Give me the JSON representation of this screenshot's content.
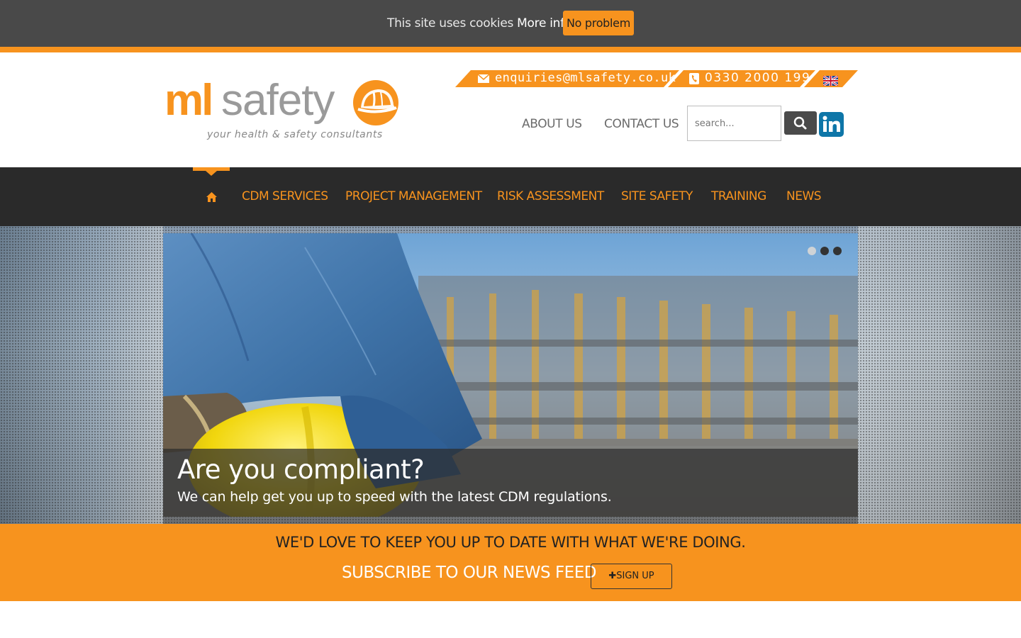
{
  "cookie_bar": {
    "text": "This site uses cookies",
    "more_info": "More info",
    "accept_label": "No problem"
  },
  "header": {
    "logo": {
      "ml": "ml",
      "safety": "safety",
      "tagline": "your health & safety consultants"
    },
    "email": "enquiries@mlsafety.co.uk",
    "phone": "0330 2000 199",
    "language_icon": "uk-flag-icon",
    "links": {
      "about": "ABOUT US",
      "contact": "CONTACT US"
    },
    "search": {
      "placeholder": "search..."
    }
  },
  "main_nav": {
    "items": [
      "CDM SERVICES",
      "PROJECT MANAGEMENT",
      "RISK ASSESSMENT",
      "SITE SAFETY",
      "TRAINING",
      "NEWS"
    ],
    "active": "home"
  },
  "hero": {
    "title": "Are you compliant?",
    "subtitle": "We can help get you up to speed with the latest CDM regulations.",
    "slides": 3,
    "active_slide": 1
  },
  "subscribe": {
    "line1": "WE'D LOVE TO KEEP YOU UP TO DATE WITH WHAT WE'RE DOING.",
    "line2": "SUBSCRIBE TO OUR NEWS FEED",
    "button": "SIGN UP"
  },
  "colors": {
    "accent": "#f7931e",
    "dark": "#2a2a2a",
    "cookie_bg": "#494949",
    "linkedin": "#0e76a8"
  }
}
